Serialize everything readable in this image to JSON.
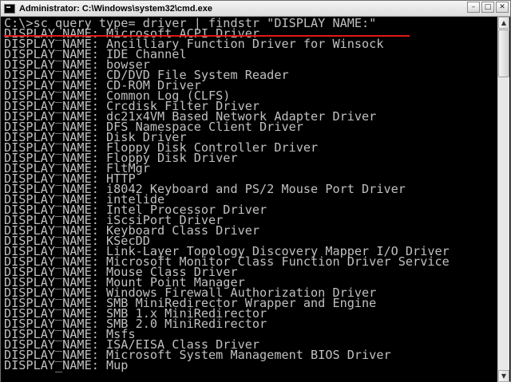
{
  "window": {
    "title": "Administrator: C:\\Windows\\system32\\cmd.exe",
    "buttons": {
      "minimize": "–",
      "maximize": "□",
      "close": "✕"
    }
  },
  "console": {
    "lines": [
      "C:\\>sc query type= driver | findstr \"DISPLAY NAME:\"",
      "DISPLAY_NAME: Microsoft ACPI Driver",
      "DISPLAY_NAME: Ancilliary Function Driver for Winsock",
      "DISPLAY_NAME: IDE Channel",
      "DISPLAY_NAME: bowser",
      "DISPLAY_NAME: CD/DVD File System Reader",
      "DISPLAY_NAME: CD-ROM Driver",
      "DISPLAY_NAME: Common Log (CLFS)",
      "DISPLAY_NAME: Crcdisk Filter Driver",
      "DISPLAY_NAME: dc21x4VM Based Network Adapter Driver",
      "DISPLAY_NAME: DFS Namespace Client Driver",
      "DISPLAY_NAME: Disk Driver",
      "DISPLAY_NAME: Floppy Disk Controller Driver",
      "DISPLAY_NAME: Floppy Disk Driver",
      "DISPLAY_NAME: FltMgr",
      "DISPLAY_NAME: HTTP",
      "DISPLAY_NAME: i8042 Keyboard and PS/2 Mouse Port Driver",
      "DISPLAY_NAME: intelide",
      "DISPLAY_NAME: Intel Processor Driver",
      "DISPLAY_NAME: iScsiPort Driver",
      "DISPLAY_NAME: Keyboard Class Driver",
      "DISPLAY_NAME: KSecDD",
      "DISPLAY_NAME: Link-Layer Topology Discovery Mapper I/O Driver",
      "DISPLAY_NAME: Microsoft Monitor Class Function Driver Service",
      "DISPLAY_NAME: Mouse Class Driver",
      "DISPLAY_NAME: Mount Point Manager",
      "DISPLAY_NAME: Windows Firewall Authorization Driver",
      "DISPLAY_NAME: SMB MiniRedirector Wrapper and Engine",
      "DISPLAY_NAME: SMB 1.x MiniRedirector",
      "DISPLAY_NAME: SMB 2.0 MiniRedirector",
      "DISPLAY_NAME: Msfs",
      "DISPLAY_NAME: ISA/EISA Class Driver",
      "DISPLAY_NAME: Microsoft System Management BIOS Driver",
      "DISPLAY_NAME: Mup"
    ]
  },
  "colors": {
    "console_background": "#000000",
    "console_text": "#c0c0c0",
    "command_underline": "#e01818"
  }
}
